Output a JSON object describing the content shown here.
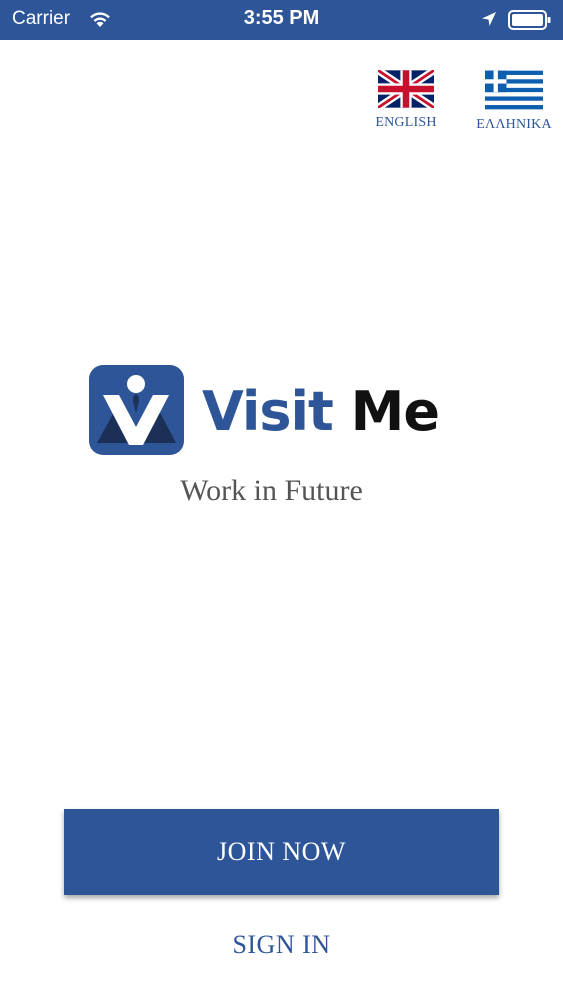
{
  "status_bar": {
    "carrier": "Carrier",
    "time": "3:55 PM",
    "background": "#2d5598",
    "icons": [
      "wifi-icon",
      "location-icon",
      "battery-icon"
    ]
  },
  "languages": [
    {
      "label": "ENGLISH",
      "flag": "uk-flag-icon"
    },
    {
      "label": "ΕΛΛΗΝΙΚΑ",
      "flag": "greek-flag-icon"
    }
  ],
  "logo": {
    "word_1": "Visit",
    "word_2": "Me",
    "mark_icon": "visit-me-logo-icon"
  },
  "tagline": "Work in Future",
  "actions": {
    "join_label": "JOIN NOW",
    "signin_label": "SIGN IN"
  },
  "colors": {
    "brand_blue": "#2d5598",
    "text_dark": "#111111",
    "tagline_gray": "#555555"
  }
}
